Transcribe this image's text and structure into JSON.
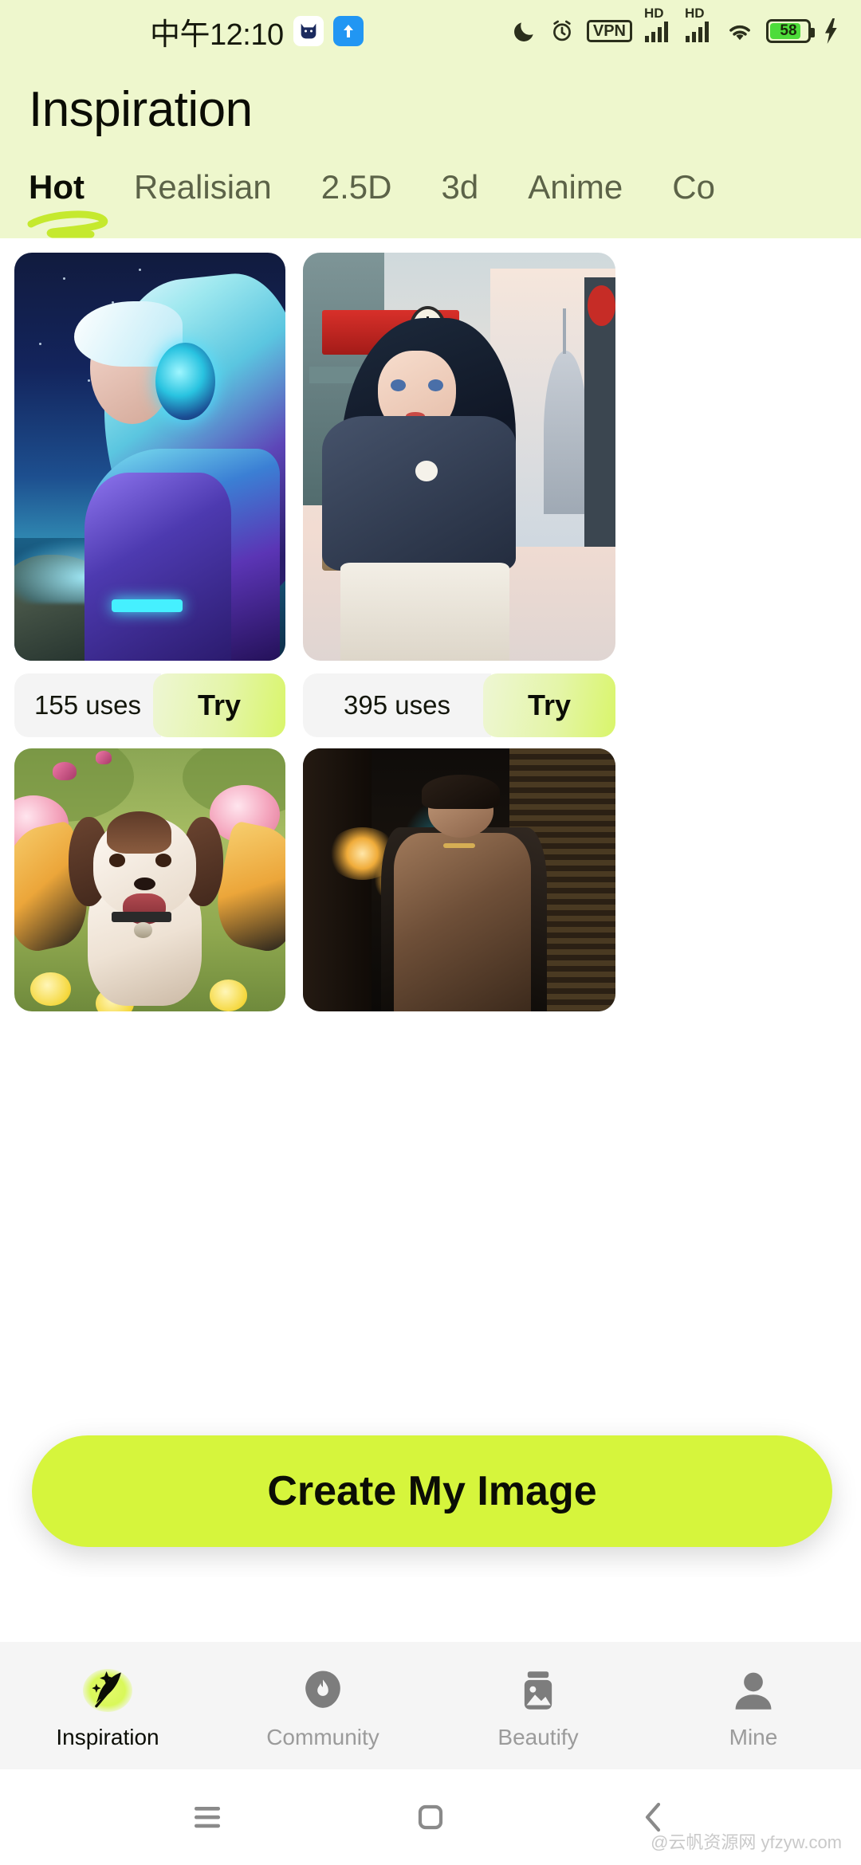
{
  "statusbar": {
    "time": "中午12:10",
    "icons_left": [
      "cat-badge-icon",
      "upload-arrow-icon"
    ],
    "icons_right": [
      "moon-icon",
      "alarm-icon",
      "vpn-icon",
      "hd-signal-icon",
      "hd-signal-icon",
      "wifi-icon",
      "battery-icon",
      "charging-bolt-icon"
    ],
    "vpn_label": "VPN",
    "hd_label": "HD",
    "battery_level": "58"
  },
  "header": {
    "title": "Inspiration"
  },
  "tabs": {
    "active_index": 0,
    "items": [
      {
        "label": "Hot"
      },
      {
        "label": "Realisian"
      },
      {
        "label": "2.5D"
      },
      {
        "label": "3d"
      },
      {
        "label": "Anime"
      },
      {
        "label": "Co"
      }
    ]
  },
  "gallery": {
    "columns": [
      {
        "cards": [
          {
            "art": "cyber-girl-headphones-night-sea",
            "uses": "155 uses",
            "try_label": "Try"
          },
          {
            "art": "puppy-butterfly-flower-garden",
            "uses": "",
            "try_label": ""
          }
        ]
      },
      {
        "cards": [
          {
            "art": "anime-girl-street-shop-city",
            "uses": "395 uses",
            "try_label": "Try"
          },
          {
            "art": "man-leather-jacket-dark-alley",
            "uses": "",
            "try_label": ""
          }
        ]
      }
    ]
  },
  "cta": {
    "label": "Create My Image"
  },
  "bottomnav": {
    "active_index": 0,
    "items": [
      {
        "label": "Inspiration",
        "icon": "feather-sparkle-icon"
      },
      {
        "label": "Community",
        "icon": "flame-bubble-icon"
      },
      {
        "label": "Beautify",
        "icon": "photo-jar-icon"
      },
      {
        "label": "Mine",
        "icon": "person-icon"
      }
    ]
  },
  "androidnav": {
    "items": [
      {
        "icon": "recents-menu-icon"
      },
      {
        "icon": "home-square-icon"
      },
      {
        "icon": "back-chevron-icon"
      }
    ]
  },
  "watermark": {
    "text": "@云帆资源网 yfzyw.com"
  },
  "colors": {
    "header_bg": "#eef7cd",
    "accent_lime": "#d6f53c",
    "tab_underline": "#c5e92e",
    "uses_pill_bg": "#f4f4f4",
    "nav_bg": "#f5f5f5",
    "battery_green": "#4ddc3a"
  }
}
